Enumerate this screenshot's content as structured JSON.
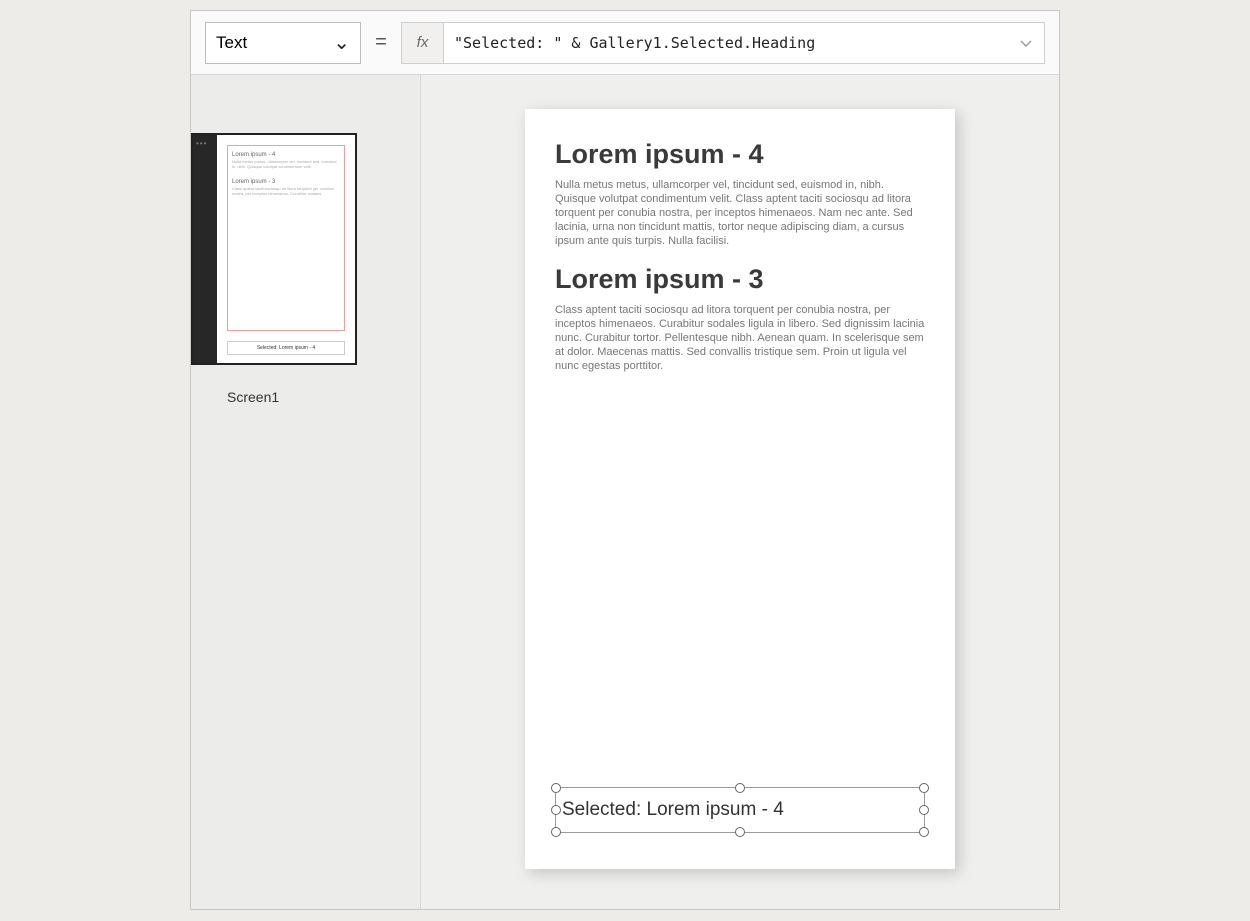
{
  "formulaBar": {
    "propertyName": "Text",
    "equals": "=",
    "fxLabel": "fx",
    "expression": "\"Selected: \" & Gallery1.Selected.Heading"
  },
  "treeView": {
    "screenLabel": "Screen1",
    "thumb": {
      "heading1": "Lorem ipsum - 4",
      "heading2": "Lorem ipsum - 3",
      "selectedText": "Selected: Lorem ipsum - 4"
    }
  },
  "canvas": {
    "gallery": [
      {
        "heading": "Lorem ipsum - 4",
        "body": "Nulla metus metus, ullamcorper vel, tincidunt sed, euismod in, nibh. Quisque volutpat condimentum velit. Class aptent taciti sociosqu ad litora torquent per conubia nostra, per inceptos himenaeos. Nam nec ante. Sed lacinia, urna non tincidunt mattis, tortor neque adipiscing diam, a cursus ipsum ante quis turpis. Nulla facilisi."
      },
      {
        "heading": "Lorem ipsum - 3",
        "body": "Class aptent taciti sociosqu ad litora torquent per conubia nostra, per inceptos himenaeos. Curabitur sodales ligula in libero. Sed dignissim lacinia nunc. Curabitur tortor. Pellentesque nibh. Aenean quam. In scelerisque sem at dolor. Maecenas mattis. Sed convallis tristique sem. Proin ut ligula vel nunc egestas porttitor."
      }
    ],
    "selectedLabel": "Selected: Lorem ipsum - 4"
  }
}
